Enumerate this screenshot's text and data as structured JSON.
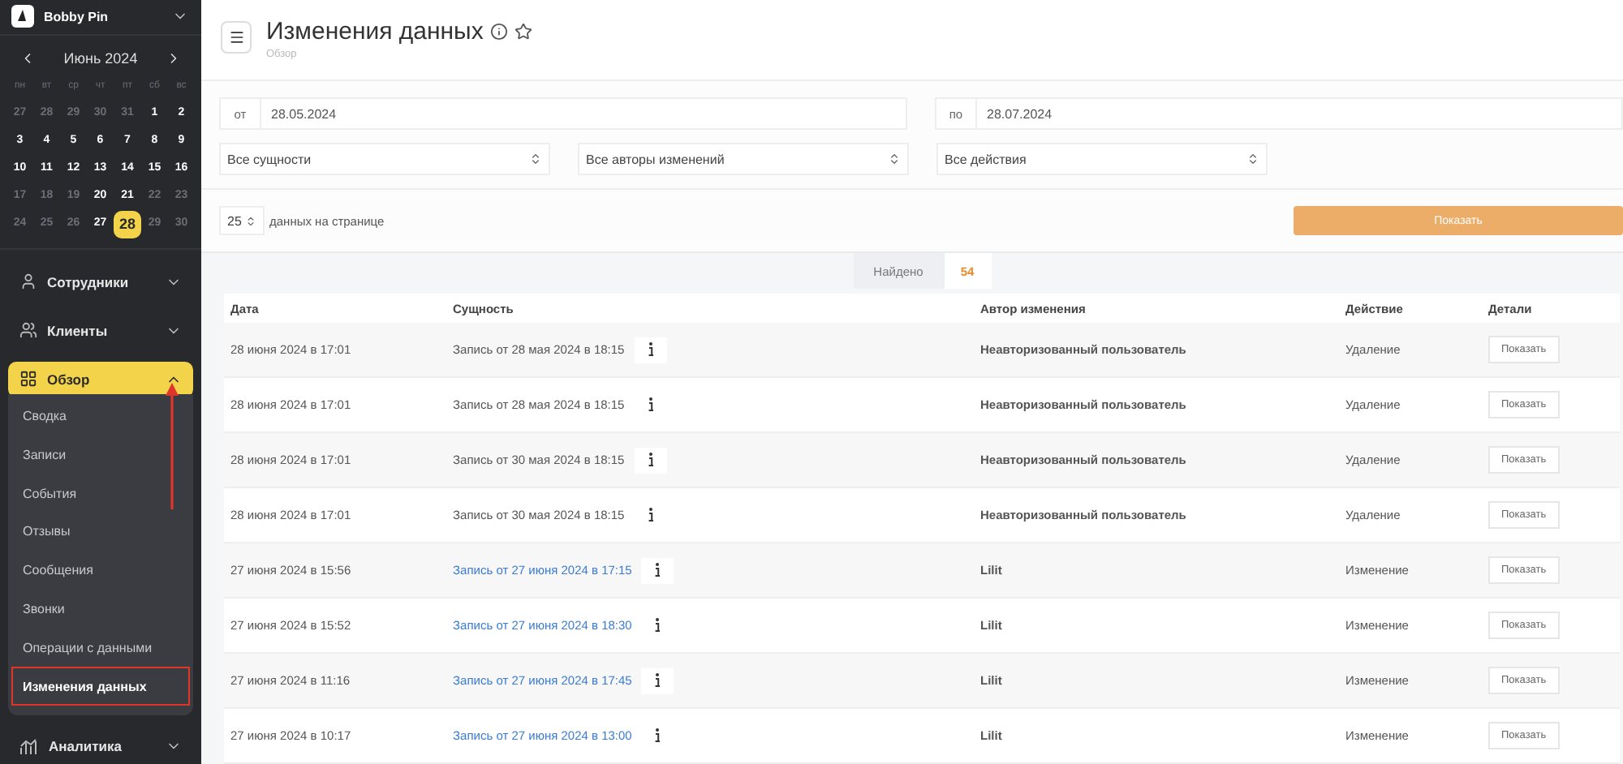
{
  "account": {
    "name": "Bobby Pin"
  },
  "calendar": {
    "month": "Июнь 2024",
    "weekdays": [
      "пн",
      "вт",
      "ср",
      "чт",
      "пт",
      "сб",
      "вс"
    ],
    "days": [
      {
        "day": "27",
        "muted": true,
        "selected": false
      },
      {
        "day": "28",
        "muted": true,
        "selected": false
      },
      {
        "day": "29",
        "muted": true,
        "selected": false
      },
      {
        "day": "30",
        "muted": true,
        "selected": false
      },
      {
        "day": "31",
        "muted": true,
        "selected": false
      },
      {
        "day": "1",
        "muted": false,
        "selected": false
      },
      {
        "day": "2",
        "muted": false,
        "selected": false
      },
      {
        "day": "3",
        "muted": false,
        "selected": false
      },
      {
        "day": "4",
        "muted": false,
        "selected": false
      },
      {
        "day": "5",
        "muted": false,
        "selected": false
      },
      {
        "day": "6",
        "muted": false,
        "selected": false
      },
      {
        "day": "7",
        "muted": false,
        "selected": false
      },
      {
        "day": "8",
        "muted": false,
        "selected": false
      },
      {
        "day": "9",
        "muted": false,
        "selected": false
      },
      {
        "day": "10",
        "muted": false,
        "selected": false
      },
      {
        "day": "11",
        "muted": false,
        "selected": false
      },
      {
        "day": "12",
        "muted": false,
        "selected": false
      },
      {
        "day": "13",
        "muted": false,
        "selected": false
      },
      {
        "day": "14",
        "muted": false,
        "selected": false
      },
      {
        "day": "15",
        "muted": false,
        "selected": false
      },
      {
        "day": "16",
        "muted": false,
        "selected": false
      },
      {
        "day": "17",
        "muted": true,
        "selected": false
      },
      {
        "day": "18",
        "muted": true,
        "selected": false
      },
      {
        "day": "19",
        "muted": true,
        "selected": false
      },
      {
        "day": "20",
        "muted": false,
        "selected": false
      },
      {
        "day": "21",
        "muted": false,
        "selected": false
      },
      {
        "day": "22",
        "muted": true,
        "selected": false
      },
      {
        "day": "23",
        "muted": true,
        "selected": false
      },
      {
        "day": "24",
        "muted": true,
        "selected": false
      },
      {
        "day": "25",
        "muted": true,
        "selected": false
      },
      {
        "day": "26",
        "muted": true,
        "selected": false
      },
      {
        "day": "27",
        "muted": false,
        "selected": false
      },
      {
        "day": "28",
        "muted": false,
        "selected": true
      },
      {
        "day": "29",
        "muted": true,
        "selected": false
      },
      {
        "day": "30",
        "muted": true,
        "selected": false
      }
    ]
  },
  "sidebar": {
    "items": [
      {
        "label": "Сотрудники",
        "kind": "user",
        "selected": false,
        "expanded": false
      },
      {
        "label": "Клиенты",
        "kind": "users",
        "selected": false,
        "expanded": false
      },
      {
        "label": "Обзор",
        "kind": "grid",
        "selected": true,
        "expanded": true,
        "children": [
          {
            "label": "Сводка",
            "selected": false,
            "outlined": false
          },
          {
            "label": "Записи",
            "selected": false,
            "outlined": false
          },
          {
            "label": "События",
            "selected": false,
            "outlined": false
          },
          {
            "label": "Отзывы",
            "selected": false,
            "outlined": false
          },
          {
            "label": "Сообщения",
            "selected": false,
            "outlined": false
          },
          {
            "label": "Звонки",
            "selected": false,
            "outlined": false
          },
          {
            "label": "Операции с данными",
            "selected": false,
            "outlined": false
          },
          {
            "label": "Изменения данных",
            "selected": true,
            "outlined": true
          }
        ]
      },
      {
        "label": "Аналитика",
        "kind": "chart",
        "selected": false,
        "expanded": false
      }
    ]
  },
  "header": {
    "title": "Изменения данных",
    "breadcrumb": "Обзор"
  },
  "filters": {
    "from": {
      "label": "от",
      "value": "28.05.2024"
    },
    "to": {
      "label": "по",
      "value": "28.07.2024"
    },
    "selects": [
      "Все сущности",
      "Все авторы изменений",
      "Все действия"
    ],
    "per_page": {
      "value": "25",
      "label": "данных на странице"
    },
    "submit": "Показать"
  },
  "found": {
    "label": "Найдено",
    "count": "54"
  },
  "table": {
    "columns": [
      "Дата",
      "Сущность",
      "Автор изменения",
      "Действие",
      "Детали"
    ],
    "rows": [
      {
        "date": "28 июня 2024 в 17:01",
        "entity": "Запись от 28 мая 2024 в 18:15",
        "link": false,
        "author": "Неавторизованный пользователь",
        "action": "Удаление",
        "details": "Показать"
      },
      {
        "date": "28 июня 2024 в 17:01",
        "entity": "Запись от 28 мая 2024 в 18:15",
        "link": false,
        "author": "Неавторизованный пользователь",
        "action": "Удаление",
        "details": "Показать"
      },
      {
        "date": "28 июня 2024 в 17:01",
        "entity": "Запись от 30 мая 2024 в 18:15",
        "link": false,
        "author": "Неавторизованный пользователь",
        "action": "Удаление",
        "details": "Показать"
      },
      {
        "date": "28 июня 2024 в 17:01",
        "entity": "Запись от 30 мая 2024 в 18:15",
        "link": false,
        "author": "Неавторизованный пользователь",
        "action": "Удаление",
        "details": "Показать"
      },
      {
        "date": "27 июня 2024 в 15:56",
        "entity": "Запись от 27 июня 2024 в 17:15",
        "link": true,
        "author": "Lilit",
        "action": "Изменение",
        "details": "Показать"
      },
      {
        "date": "27 июня 2024 в 15:52",
        "entity": "Запись от 27 июня 2024 в 18:30",
        "link": true,
        "author": "Lilit",
        "action": "Изменение",
        "details": "Показать"
      },
      {
        "date": "27 июня 2024 в 11:16",
        "entity": "Запись от 27 июня 2024 в 17:45",
        "link": true,
        "author": "Lilit",
        "action": "Изменение",
        "details": "Показать"
      },
      {
        "date": "27 июня 2024 в 10:17",
        "entity": "Запись от 27 июня 2024 в 13:00",
        "link": true,
        "author": "Lilit",
        "action": "Изменение",
        "details": "Показать"
      }
    ]
  }
}
